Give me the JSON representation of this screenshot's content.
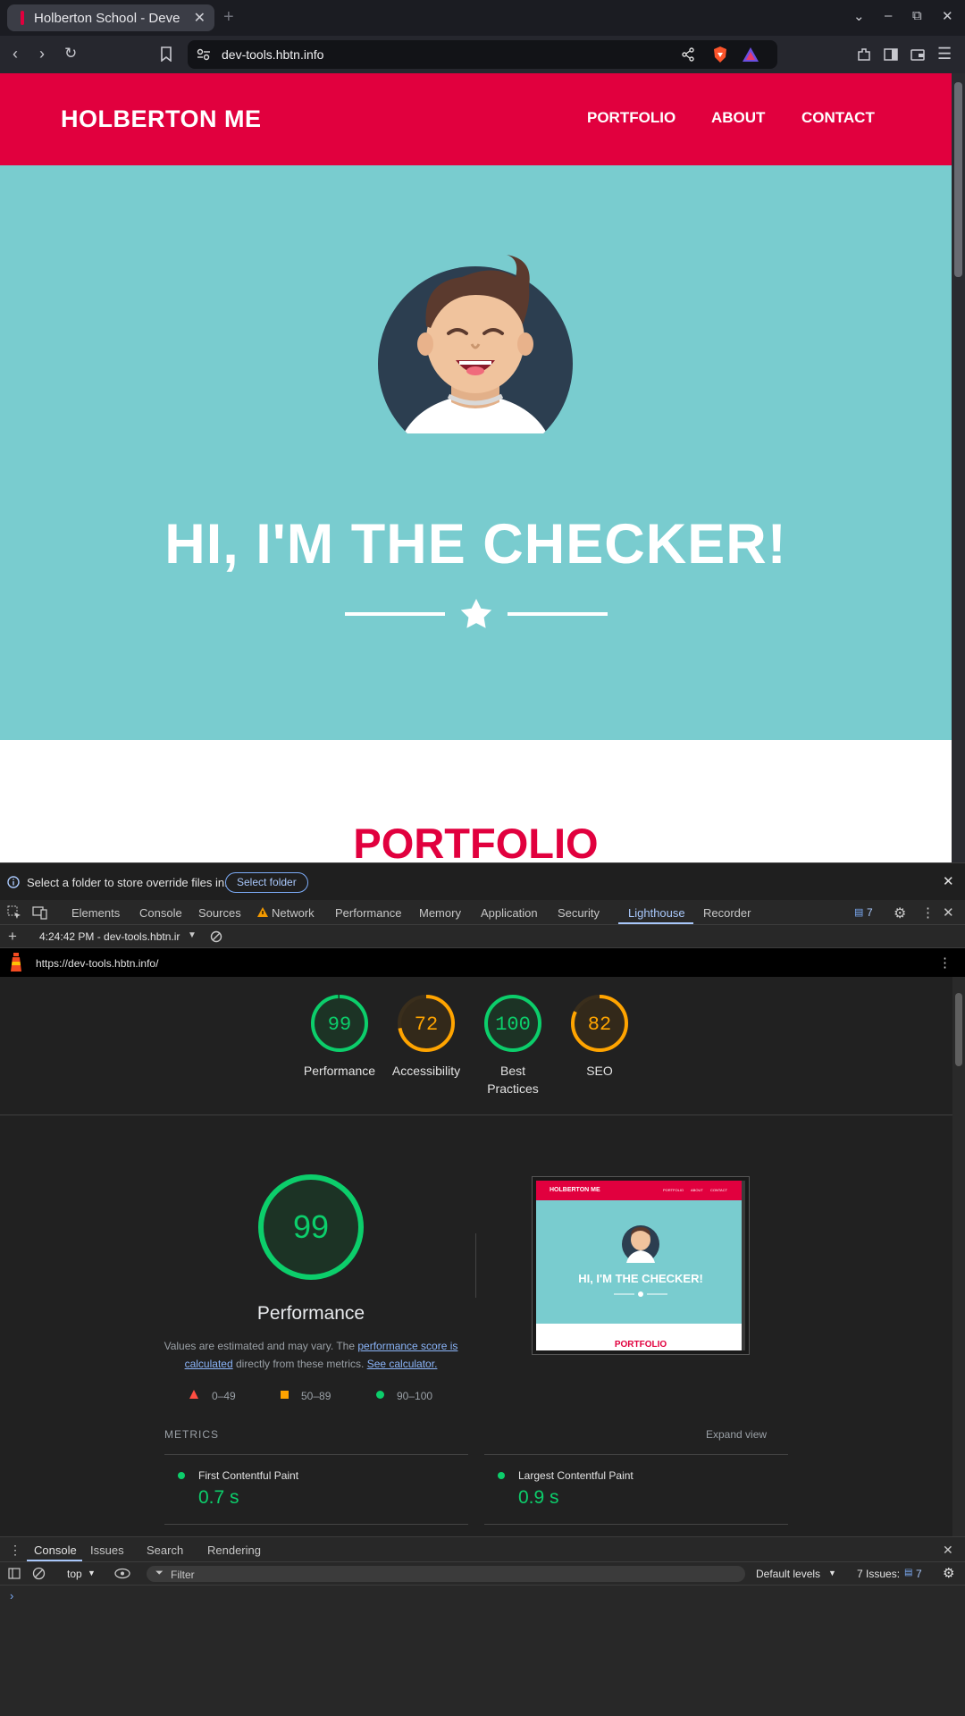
{
  "browser": {
    "tab_title": "Holberton School - Deve",
    "url": "dev-tools.hbtn.info"
  },
  "site": {
    "brand": "HOLBERTON ME",
    "nav": [
      "PORTFOLIO",
      "ABOUT",
      "CONTACT"
    ],
    "hero_title": "HI, I'M THE CHECKER!",
    "section_heading": "PORTFOLIO"
  },
  "devtools": {
    "info_message": "Select a folder to store override files in.",
    "select_folder_label": "Select folder",
    "tabs": [
      "Elements",
      "Console",
      "Sources",
      "Network",
      "Performance",
      "Memory",
      "Application",
      "Security",
      "Lighthouse",
      "Recorder"
    ],
    "active_tab": "Lighthouse",
    "issues_count": "7",
    "report_selector": "4:24:42 PM - dev-tools.hbtn.ir",
    "report_url": "https://dev-tools.hbtn.info/",
    "drawer_tabs": [
      "Console",
      "Issues",
      "Search",
      "Rendering"
    ],
    "console_context": "top",
    "filter_placeholder": "Filter",
    "default_levels": "Default levels",
    "issues_label": "7 Issues:",
    "issues_badge": "7"
  },
  "lighthouse": {
    "scores": [
      {
        "label": "Performance",
        "score": 99,
        "color": "#0cce6b"
      },
      {
        "label": "Accessibility",
        "score": 72,
        "color": "#ffa400"
      },
      {
        "label": "Best Practices",
        "score": 100,
        "color": "#0cce6b"
      },
      {
        "label": "SEO",
        "score": 82,
        "color": "#ffa400"
      }
    ],
    "performance": {
      "score": "99",
      "title": "Performance",
      "note_prefix": "Values are estimated and may vary. The ",
      "note_link1": "performance score is calculated",
      "note_mid": " directly from these metrics. ",
      "note_link2": "See calculator."
    },
    "legend": [
      "0–49",
      "50–89",
      "90–100"
    ],
    "metrics_heading": "METRICS",
    "expand_view": "Expand view",
    "metrics": [
      {
        "label": "First Contentful Paint",
        "value": "0.7 s"
      },
      {
        "label": "Largest Contentful Paint",
        "value": "0.9 s"
      }
    ],
    "thumbnail": {
      "brand": "HOLBERTON ME",
      "nav": [
        "PORTFOLIO",
        "ABOUT",
        "CONTACT"
      ],
      "hero_title": "HI, I'M THE CHECKER!",
      "section_heading": "PORTFOLIO"
    }
  },
  "colors": {
    "brand_red": "#e1003e",
    "hero_teal": "#79cccf",
    "pass_green": "#0cce6b",
    "average_orange": "#ffa400",
    "fail_red": "#ff4e42"
  }
}
